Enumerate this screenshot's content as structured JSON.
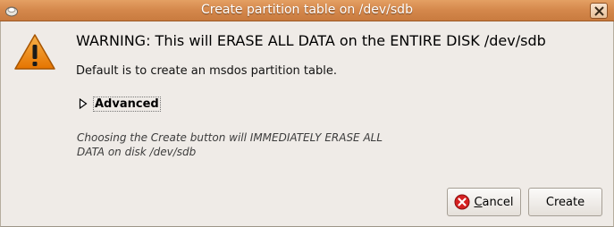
{
  "window": {
    "title": "Create partition table on /dev/sdb"
  },
  "dialog": {
    "warning": "WARNING:  This will ERASE ALL DATA on the ENTIRE DISK /dev/sdb",
    "default_note": "Default is to create an msdos partition table.",
    "advanced_label": "Advanced",
    "erase_note_line1": "Choosing the Create button will IMMEDIATELY ERASE ALL",
    "erase_note_line2": "DATA on disk /dev/sdb"
  },
  "buttons": {
    "cancel_mnemonic": "C",
    "cancel_rest": "ancel",
    "create_label": "Create"
  },
  "icons": {
    "app": "gparted-app-icon",
    "close": "close-icon",
    "warning": "warning-icon",
    "expander": "expander-arrow-icon",
    "cancel": "cancel-icon"
  },
  "colors": {
    "titlebar": "#d4874b",
    "background": "#efebe7",
    "warning_orange": "#f08a1d"
  }
}
